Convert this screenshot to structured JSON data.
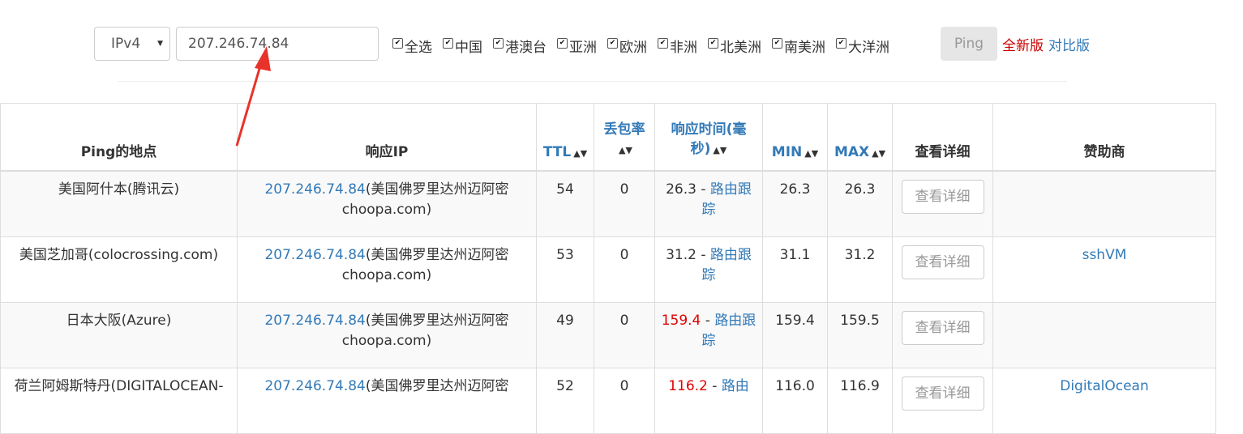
{
  "toolbar": {
    "ip_version": "IPv4",
    "address_value": "207.246.74.84",
    "regions": [
      {
        "label": "全选",
        "checked": true
      },
      {
        "label": "中国",
        "checked": true
      },
      {
        "label": "港澳台",
        "checked": true
      },
      {
        "label": "亚洲",
        "checked": true
      },
      {
        "label": "欧洲",
        "checked": true
      },
      {
        "label": "非洲",
        "checked": true
      },
      {
        "label": "北美洲",
        "checked": true
      },
      {
        "label": "南美洲",
        "checked": true
      },
      {
        "label": "大洋洲",
        "checked": true
      }
    ],
    "ping_label": "Ping",
    "new_version_label": "全新版",
    "compare_label": "对比版"
  },
  "table": {
    "headers": {
      "location": "Ping的地点",
      "ip": "响应IP",
      "ttl": "TTL",
      "loss": "丢包率",
      "time": "响应时间(毫秒)",
      "min": "MIN",
      "max": "MAX",
      "detail": "查看详细",
      "sponsor": "赞助商"
    },
    "rows": [
      {
        "location": "美国阿什本(腾讯云)",
        "ip": "207.246.74.84",
        "ip_info": "(美国佛罗里达州迈阿密choopa.com)",
        "ttl": "54",
        "loss": "0",
        "time": "26.3",
        "slow": false,
        "sep": " - ",
        "route": "路由跟踪",
        "min": "26.3",
        "max": "26.3",
        "detail": "查看详细",
        "sponsor": ""
      },
      {
        "location": "美国芝加哥(colocrossing.com)",
        "ip": "207.246.74.84",
        "ip_info": "(美国佛罗里达州迈阿密choopa.com)",
        "ttl": "53",
        "loss": "0",
        "time": "31.2",
        "slow": false,
        "sep": " - ",
        "route": "路由跟踪",
        "min": "31.1",
        "max": "31.2",
        "detail": "查看详细",
        "sponsor": "sshVM"
      },
      {
        "location": "日本大阪(Azure)",
        "ip": "207.246.74.84",
        "ip_info": "(美国佛罗里达州迈阿密choopa.com)",
        "ttl": "49",
        "loss": "0",
        "time": "159.4",
        "slow": true,
        "sep": " - ",
        "route": "路由跟踪",
        "min": "159.4",
        "max": "159.5",
        "detail": "查看详细",
        "sponsor": ""
      },
      {
        "location": "荷兰阿姆斯特丹(DIGITALOCEAN-",
        "ip": "207.246.74.84",
        "ip_info": "(美国佛罗里达州迈阿密",
        "ttl": "52",
        "loss": "0",
        "time": "116.2",
        "slow": true,
        "sep": " - ",
        "route": "路由",
        "min": "116.0",
        "max": "116.9",
        "detail": "查看详细",
        "sponsor": "DigitalOcean"
      }
    ]
  },
  "colors": {
    "link": "#337ab7",
    "slow": "#e00000",
    "annotation_arrow": "#e8332a"
  }
}
